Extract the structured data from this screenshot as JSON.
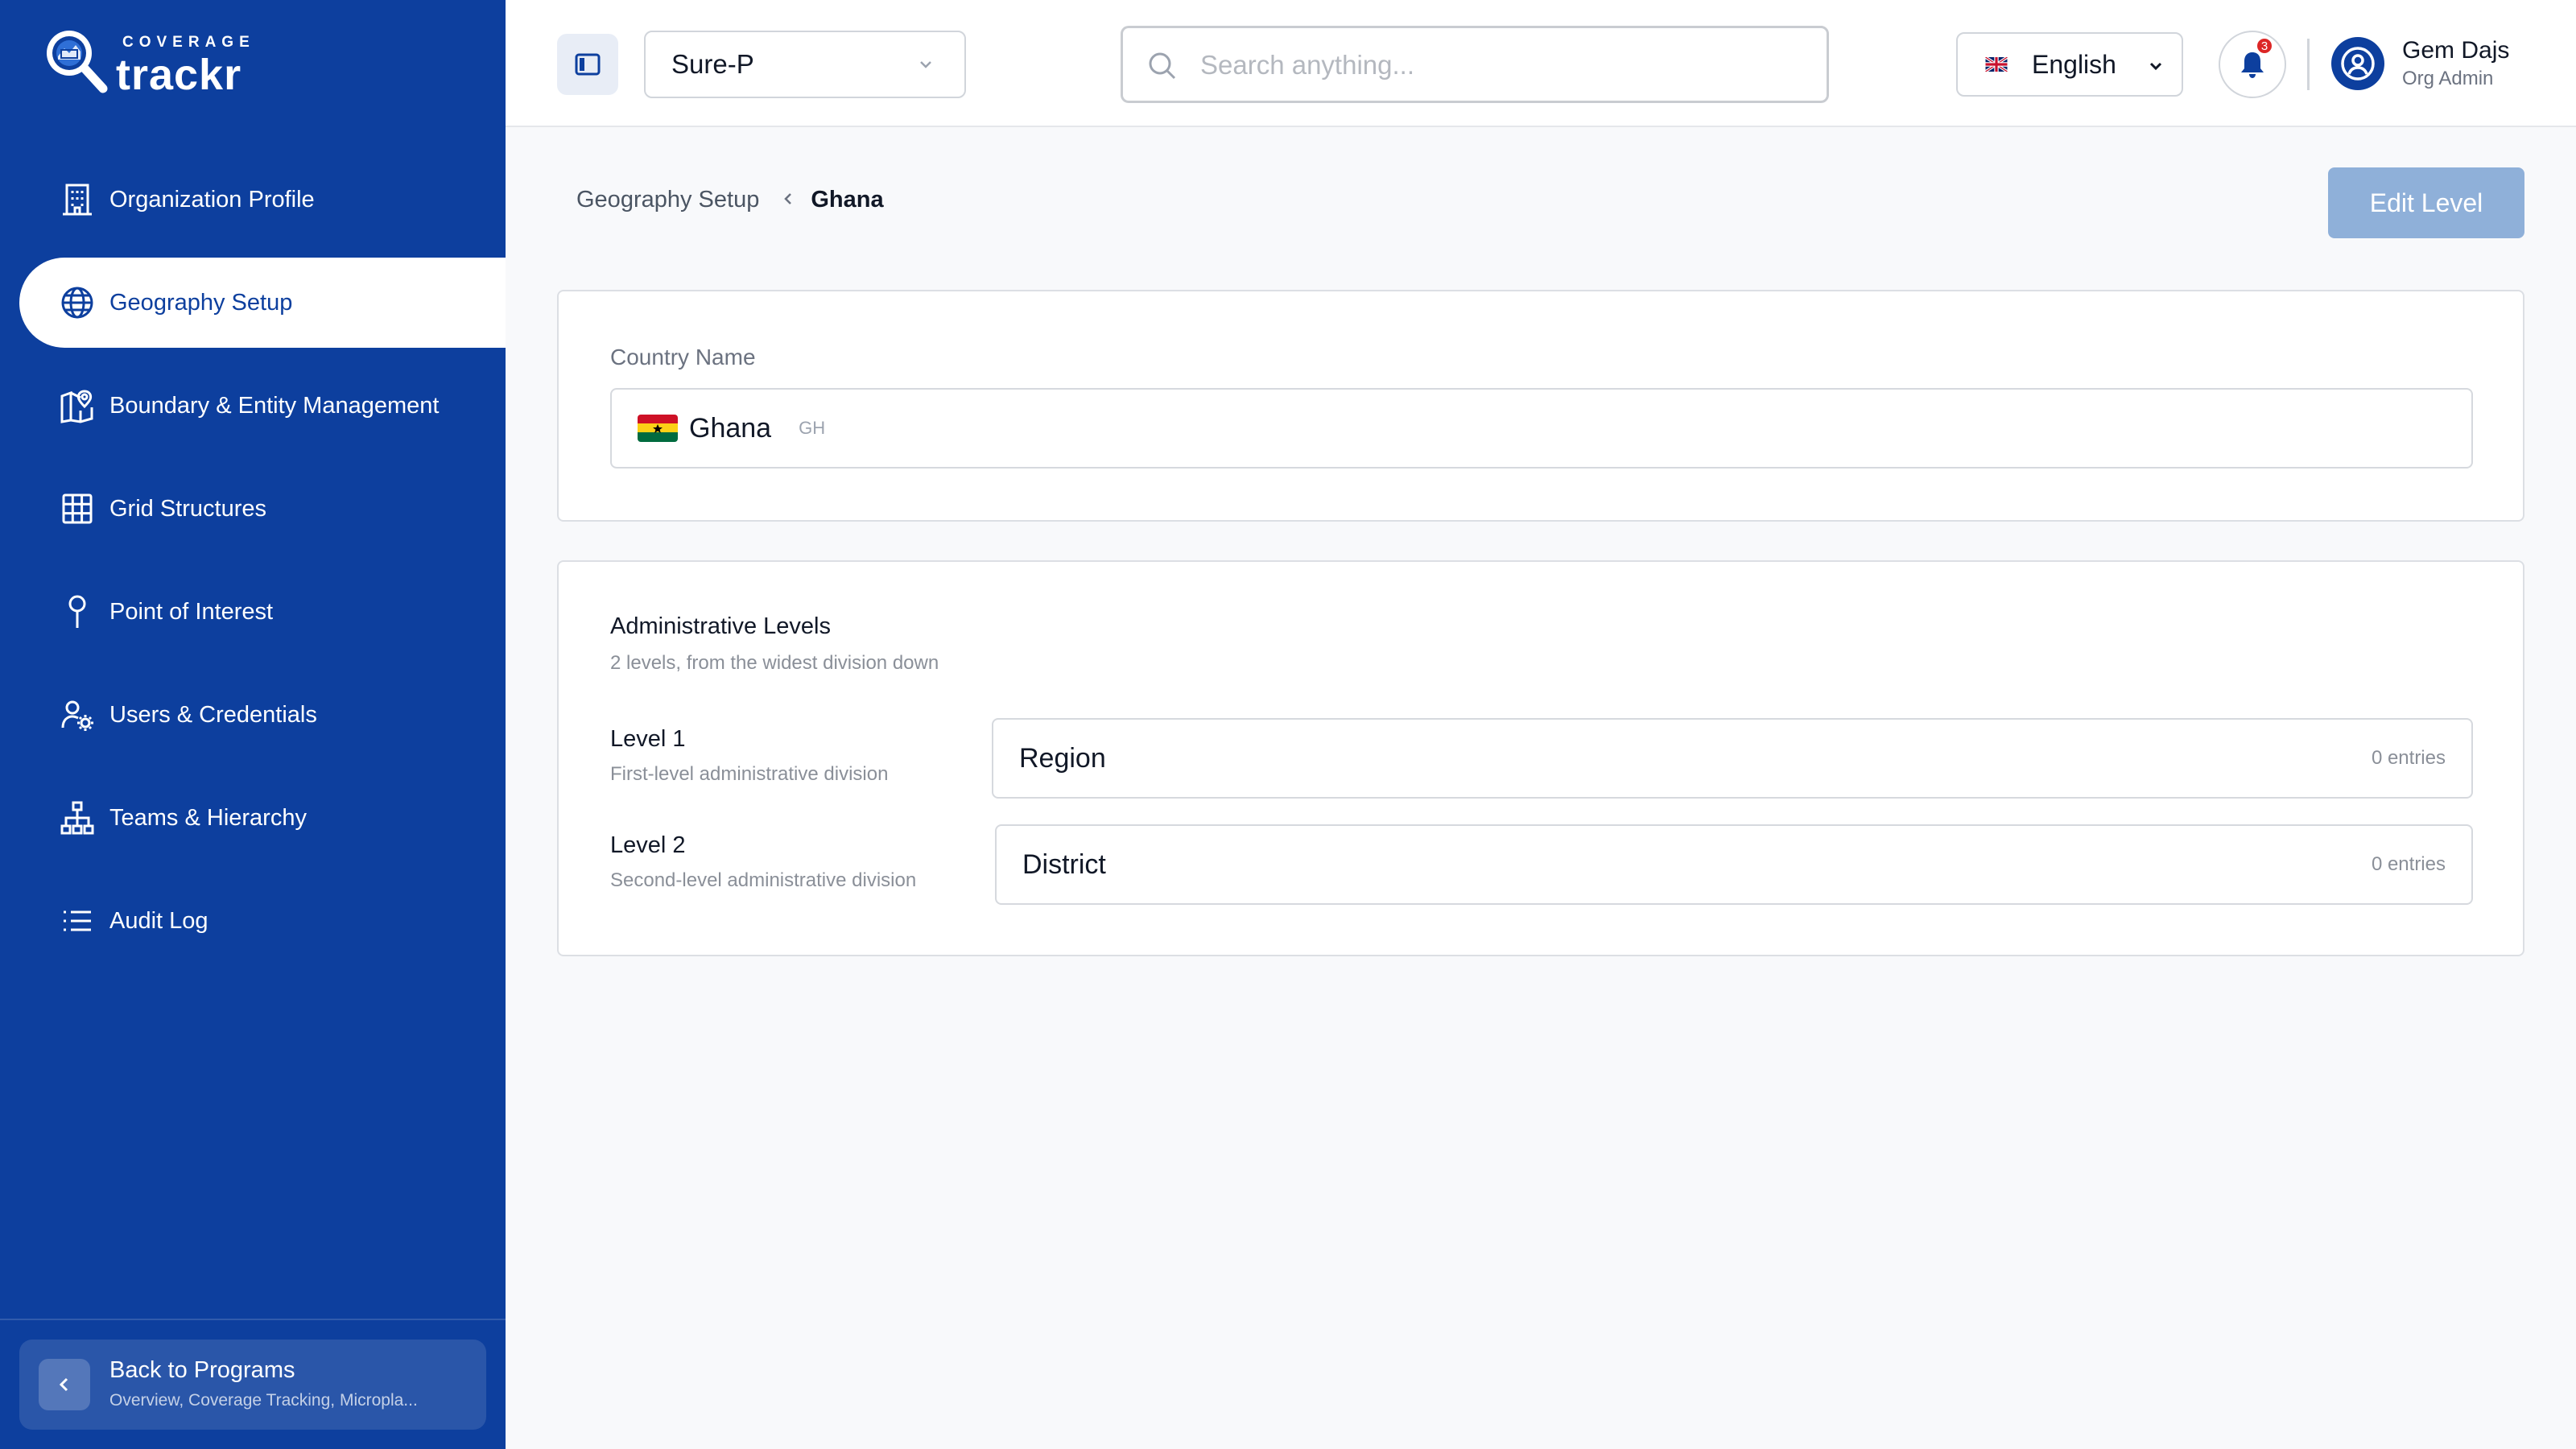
{
  "brand": {
    "sub": "COVERAGE",
    "main": "trackr"
  },
  "sidebar": {
    "items": [
      {
        "label": "Organization Profile",
        "icon": "building-icon"
      },
      {
        "label": "Geography Setup",
        "icon": "globe-icon",
        "active": true
      },
      {
        "label": "Boundary & Entity Management",
        "icon": "map-pin-icon"
      },
      {
        "label": "Grid Structures",
        "icon": "grid-icon"
      },
      {
        "label": "Point of Interest",
        "icon": "pin-icon"
      },
      {
        "label": "Users & Credentials",
        "icon": "user-gear-icon"
      },
      {
        "label": "Teams & Hierarchy",
        "icon": "hierarchy-icon"
      },
      {
        "label": "Audit Log",
        "icon": "list-icon"
      }
    ],
    "back": {
      "title": "Back to Programs",
      "subtitle": "Overview, Coverage Tracking, Micropla..."
    }
  },
  "header": {
    "program": "Sure-P",
    "search_placeholder": "Search anything...",
    "language": "English",
    "notifications_count": "3",
    "user": {
      "name": "Gem Dajs",
      "role": "Org Admin"
    }
  },
  "breadcrumb": {
    "parent": "Geography Setup",
    "current": "Ghana"
  },
  "actions": {
    "edit_level": "Edit Level"
  },
  "country": {
    "label": "Country Name",
    "name": "Ghana",
    "code": "GH"
  },
  "levels": {
    "title": "Administrative Levels",
    "subtitle": "2 levels, from the widest division down",
    "items": [
      {
        "name": "Level 1",
        "description": "First-level administrative division",
        "value": "Region",
        "count": "0 entries"
      },
      {
        "name": "Level 2",
        "description": "Second-level administrative division",
        "value": "District",
        "count": "0 entries"
      }
    ]
  },
  "colors": {
    "brand": "#0d3f9e",
    "accent_button": "#8fb0d9",
    "badge": "#dc2626"
  }
}
